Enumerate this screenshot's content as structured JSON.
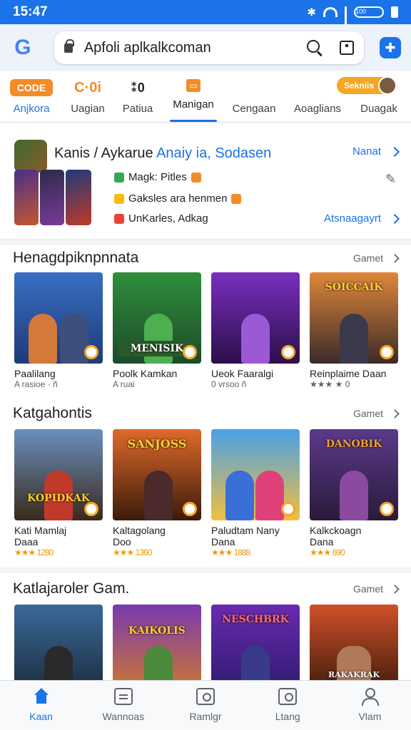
{
  "status_bar": {
    "time": "15:47",
    "battery_label": "100"
  },
  "browser": {
    "url": "Apfoli aplkalkcoman",
    "ext_icon": "puzzle-icon"
  },
  "categories": [
    {
      "badge": "CODE",
      "label": "Anjkora",
      "color": "#f28c28"
    },
    {
      "badge": "C·0i",
      "label": "Uagian",
      "color": "#f28c28"
    },
    {
      "badge": "⁑0",
      "label": "Patiua",
      "color": "#202124"
    },
    {
      "badge": "▭",
      "label": "Manigan",
      "color": "#f28c28"
    },
    {
      "badge": "",
      "label": "Cengaan",
      "color": "#3c4043"
    },
    {
      "badge": "",
      "label": "Aoaglians",
      "color": "#3c4043"
    },
    {
      "badge": "",
      "label": "Duagak",
      "color": "#3c4043"
    }
  ],
  "profile_chip": "Sekniis",
  "featured": {
    "title_part1": "Kanis / Aykarue",
    "title_part2": "Anaiy ia, Sodasen",
    "line1": "Magk: Pitles",
    "line2": "Gaksles ara henmen",
    "line3": "UnKarles, Adkag",
    "link1": "Nanat",
    "link2": "Atsnaagayrt",
    "pin_icon": "pin-icon"
  },
  "sections": [
    {
      "title": "Henagdpiknpnnata",
      "more": "Gamet",
      "games": [
        {
          "banner": "",
          "name": "Paalilang",
          "sub": "A rasioe ·  ñ"
        },
        {
          "banner": "MENISIK",
          "name": "Poolk Kamkan",
          "sub": "A ruai"
        },
        {
          "banner": "",
          "name": "Ueok Faaralgi",
          "sub": "0 vrsoo  ñ"
        },
        {
          "banner": "SOICCAIK",
          "name": "Reinplaime Daan",
          "sub": "★★★ ★   0"
        }
      ]
    },
    {
      "title": "Katgahontis",
      "more": "Gamet",
      "games": [
        {
          "banner": "KOPIDKAK",
          "name": "Kati Mamlaj",
          "name2": "Daaa",
          "sub": "★★★ 1280"
        },
        {
          "banner": "SANJOSS",
          "name": "Kaltagolang",
          "name2": "Doo",
          "sub": "★★★ 1360"
        },
        {
          "banner": "",
          "name": "Paludtam Nany",
          "name2": "Dana",
          "sub": "★★★ 1888"
        },
        {
          "banner": "DANOBIK",
          "name": "Kalkckoagn",
          "name2": "Dana",
          "sub": "★★★ 690"
        }
      ]
    },
    {
      "title": "Katlajaroler Gam.",
      "more": "Gamet",
      "games": [
        {
          "banner": ""
        },
        {
          "banner": "KAIKOLIS"
        },
        {
          "banner": "NESCHBRK"
        },
        {
          "banner": "RAKAKRAK"
        }
      ]
    }
  ],
  "bottom_nav": [
    {
      "label": "Kaan",
      "icon": "home-icon"
    },
    {
      "label": "Wannoas",
      "icon": "list-icon"
    },
    {
      "label": "Ramlgr",
      "icon": "camera-icon"
    },
    {
      "label": "Ltang",
      "icon": "bag-icon"
    },
    {
      "label": "Vlam",
      "icon": "person-icon"
    }
  ],
  "colors": {
    "accent": "#1a73e8",
    "star": "#f29900",
    "badge": "#f28c28"
  }
}
